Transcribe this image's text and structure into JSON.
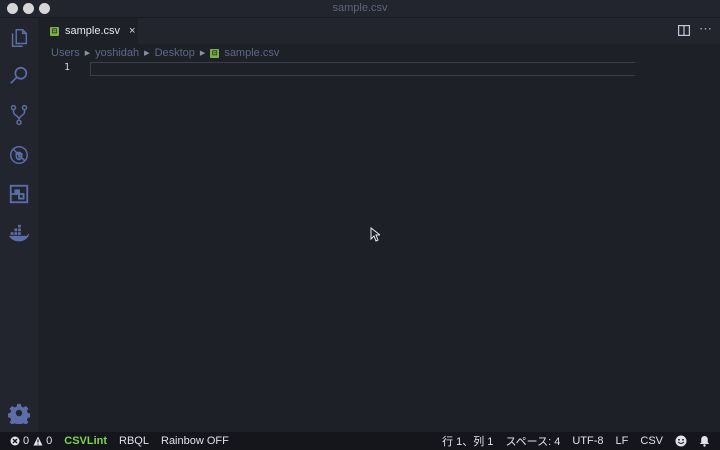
{
  "window": {
    "title": "sample.csv"
  },
  "tab": {
    "label": "sample.csv",
    "file_icon": "csv-file-icon",
    "close_glyph": "×"
  },
  "breadcrumb": [
    "Users",
    "yoshidah",
    "Desktop",
    "sample.csv"
  ],
  "editor": {
    "line_numbers": [
      "1"
    ]
  },
  "status": {
    "errors": "0",
    "warnings": "0",
    "csvlint": "CSVLint",
    "rbql": "RBQL",
    "rainbow": "Rainbow OFF",
    "position": "行 1、列 1",
    "spaces": "スペース: 4",
    "encoding": "UTF-8",
    "eol": "LF",
    "language": "CSV"
  },
  "colors": {
    "accent_green": "#7ed44e",
    "csv_icon": "#7ab342",
    "background": "#1e2028",
    "sidebar": "#23252e",
    "statusbar": "#15161c"
  },
  "icons": [
    "files-icon",
    "search-icon",
    "source-control-icon",
    "debug-icon",
    "extensions-icon",
    "docker-icon",
    "gear-icon",
    "split-editor-icon",
    "more-icon",
    "error-icon",
    "warning-icon",
    "smiley-icon",
    "bell-icon"
  ]
}
